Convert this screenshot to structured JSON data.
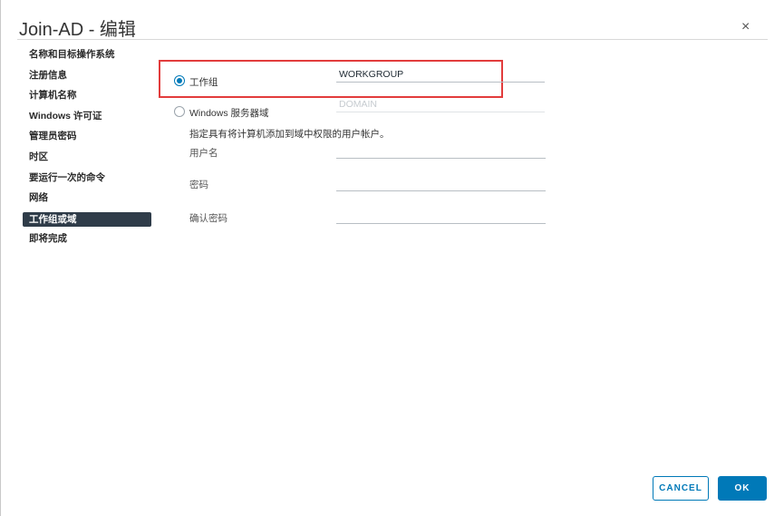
{
  "dialog": {
    "title": "Join-AD - 编辑",
    "close_glyph": "×"
  },
  "nav": {
    "items": [
      "名称和目标操作系统",
      "注册信息",
      "计算机名称",
      "Windows 许可证",
      "管理员密码",
      "时区",
      "要运行一次的命令",
      "网络",
      "工作组或域",
      "即将完成"
    ],
    "active": "工作组或域"
  },
  "form": {
    "workgroup_option": "工作组",
    "workgroup_value": "WORKGROUP",
    "domain_option": "Windows 服务器域",
    "domain_placeholder": "DOMAIN",
    "hint": "指定具有将计算机添加到域中权限的用户帐户。",
    "username_label": "用户名",
    "password_label": "密码",
    "confirm_password_label": "确认密码",
    "selected_option": "工作组"
  },
  "buttons": {
    "cancel": "CANCEL",
    "ok": "OK"
  },
  "colors": {
    "accent": "#0079b8",
    "nav_active_bg": "#2f3c49",
    "highlight": "#e23c3c"
  }
}
